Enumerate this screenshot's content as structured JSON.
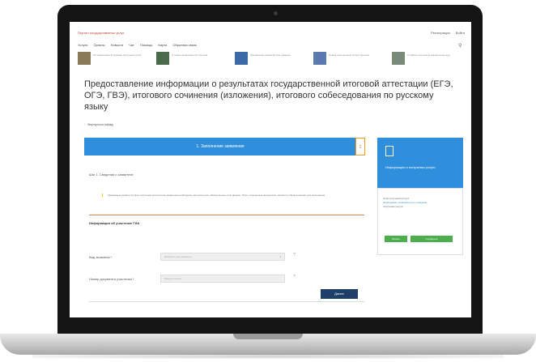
{
  "site": {
    "link_text": "Портал государственных услуг",
    "account_links": [
      "Войти",
      "Регистрация"
    ],
    "nav_items": [
      "Услуги",
      "Органы",
      "Новости",
      "Чат",
      "Помощь",
      "Карта",
      "Обратная связь"
    ]
  },
  "news": [
    {
      "text": "Об изменениях в порядке получения услуг"
    },
    {
      "text": "О новых возможностях портала"
    },
    {
      "text": "Обновление сервисов для граждан"
    },
    {
      "text": "Новые электронные услуги региона"
    },
    {
      "text": "О работе портала в праздничные дни"
    }
  ],
  "page": {
    "title": "Предоставление информации о результатах государственной итоговой аттестации (ЕГЭ, ОГЭ, ГВЭ), итогового сочинения (изложения), итогового собеседования по русскому языку",
    "back_label": "Вернуться назад"
  },
  "stepper": {
    "current_label": "1. Заполнение заявления",
    "badge": "2"
  },
  "form": {
    "step_label": "Шаг 1. Сведения о заявителе",
    "alert_text": "Уважаемые заявители! Для получения результатов экзаменов необходимо заполнить все обязательные поля формы. Поля, отмеченные звездочкой, являются обязательными для заполнения.",
    "section_title": "Информация об участнике ГИА",
    "fields": [
      {
        "label": "Вид экзамена *",
        "value": "Выберите вид экзамена",
        "help": "?"
      },
      {
        "label": "Номер документа участника *",
        "value": "Введите номер",
        "help": "?"
      }
    ],
    "next_button": "Далее"
  },
  "sidebar": {
    "title": "Информация о получении услуги",
    "text_lines": [
      "Срок получения услуги:",
      "Необходимо ознакомиться с порядком",
      "получения услуги"
    ],
    "link_text": "порядком",
    "buttons": [
      "Печать",
      "Сохранить"
    ]
  },
  "colors": {
    "accent": "#2f8fdc",
    "dark_button": "#1f3f6b",
    "green": "#4cae4c",
    "link_red": "#c0392b"
  }
}
